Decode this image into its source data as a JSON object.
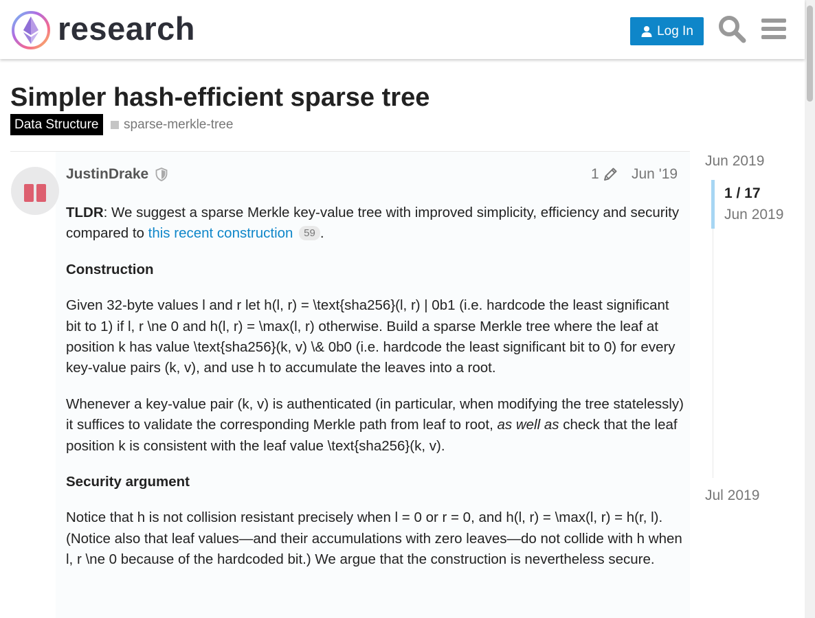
{
  "header": {
    "site_name": "research",
    "login_label": "Log In"
  },
  "topic": {
    "title": "Simpler hash-efficient sparse tree",
    "category": "Data Structure",
    "tag": "sparse-merkle-tree"
  },
  "post": {
    "username": "JustinDrake",
    "edit_count": "1",
    "date": "Jun '19",
    "tldr_label": "TLDR",
    "tldr_text_1": ": We suggest a sparse Merkle key-value tree with improved simplicity, efficiency and security compared to ",
    "tldr_link": "this recent construction",
    "tldr_link_clicks": "59",
    "tldr_end": ".",
    "heading_construction": "Construction",
    "para_construction": "Given 32-byte values l and r let h(l, r) = \\text{sha256}(l, r) | 0b1 (i.e. hardcode the least significant bit to 1) if l, r \\ne 0 and h(l, r) = \\max(l, r) otherwise. Build a sparse Merkle tree where the leaf at position k has value \\text{sha256}(k, v) \\& 0b0 (i.e. hardcode the least significant bit to 0) for every key-value pairs (k, v), and use h to accumulate the leaves into a root.",
    "para_auth_1": "Whenever a key-value pair (k, v) is authenticated (in particular, when modifying the tree statelessly) it suffices to validate the corresponding Merkle path from leaf to root, ",
    "para_auth_em": "as well as",
    "para_auth_2": " check that the leaf position k is consistent with the leaf value \\text{sha256}(k, v).",
    "heading_security": "Security argument",
    "para_security": "Notice that h is not collision resistant precisely when l = 0 or r = 0, and h(l, r) = \\max(l, r) = h(r, l). (Notice also that leaf values—and their accumulations with zero leaves—do not collide with h when l, r \\ne 0 because of the hardcoded bit.) We argue that the construction is nevertheless secure."
  },
  "timeline": {
    "start": "Jun 2019",
    "position": "1 / 17",
    "position_date": "Jun 2019",
    "end": "Jul 2019"
  },
  "colors": {
    "accent": "#0e86c9",
    "category_bg": "#000000",
    "timeline_handle": "#a7d6f3"
  },
  "icons": [
    "ethereum-logo-icon",
    "user-icon",
    "search-icon",
    "hamburger-menu-icon",
    "shield-icon",
    "pencil-icon"
  ]
}
